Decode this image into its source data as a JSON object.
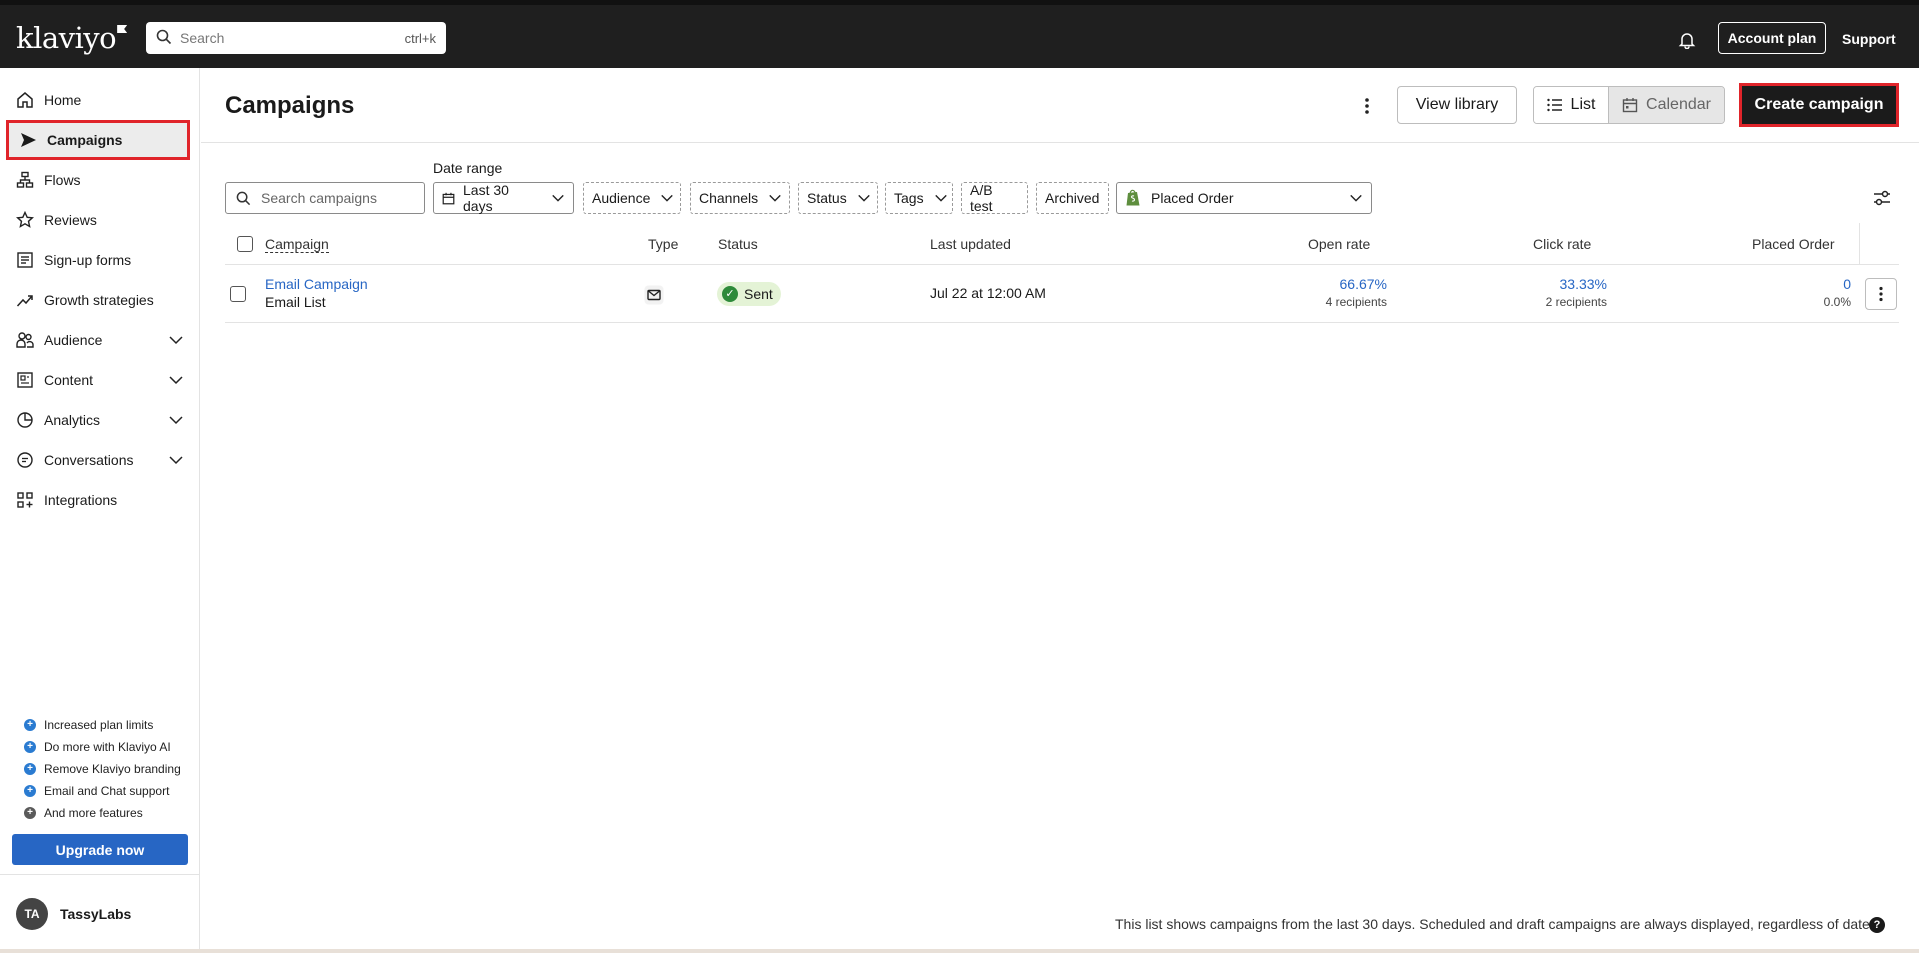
{
  "topbar": {
    "logo": "klaviyo",
    "search_placeholder": "Search",
    "search_shortcut": "ctrl+k",
    "account_plan": "Account plan",
    "support": "Support"
  },
  "sidebar": {
    "items": [
      {
        "label": "Home",
        "icon": "home-icon"
      },
      {
        "label": "Campaigns",
        "icon": "send-icon"
      },
      {
        "label": "Flows",
        "icon": "flows-icon"
      },
      {
        "label": "Reviews",
        "icon": "star-icon"
      },
      {
        "label": "Sign-up forms",
        "icon": "form-icon"
      },
      {
        "label": "Growth strategies",
        "icon": "trend-icon"
      },
      {
        "label": "Audience",
        "icon": "people-icon"
      },
      {
        "label": "Content",
        "icon": "content-icon"
      },
      {
        "label": "Analytics",
        "icon": "pie-icon"
      },
      {
        "label": "Conversations",
        "icon": "chat-icon"
      },
      {
        "label": "Integrations",
        "icon": "grid-icon"
      }
    ],
    "perks": [
      "Increased plan limits",
      "Do more with Klaviyo AI",
      "Remove Klaviyo branding",
      "Email and Chat support",
      "And more features"
    ],
    "upgrade_label": "Upgrade now",
    "account_initials": "TA",
    "account_name": "TassyLabs"
  },
  "main": {
    "title": "Campaigns",
    "view_library": "View library",
    "view_list": "List",
    "view_calendar": "Calendar",
    "create_campaign": "Create campaign",
    "date_range_label": "Date range",
    "search_placeholder": "Search campaigns",
    "filters": {
      "date": "Last 30 days",
      "audience": "Audience",
      "channels": "Channels",
      "status": "Status",
      "tags": "Tags",
      "ab_test": "A/B test",
      "archived": "Archived",
      "metric": "Placed Order"
    },
    "table": {
      "headers": {
        "campaign": "Campaign",
        "type": "Type",
        "status": "Status",
        "last_updated": "Last updated",
        "open_rate": "Open rate",
        "click_rate": "Click rate",
        "placed_order": "Placed Order"
      },
      "rows": [
        {
          "name": "Email Campaign",
          "list": "Email List",
          "status": "Sent",
          "last_updated": "Jul 22 at 12:00 AM",
          "open_rate": "66.67%",
          "open_recipients": "4 recipients",
          "click_rate": "33.33%",
          "click_recipients": "2 recipients",
          "placed_order": "0",
          "placed_order_pct": "0.0%"
        }
      ]
    },
    "footer_note": "This list shows campaigns from the last 30 days. Scheduled and draft campaigns are always displayed, regardless of date.",
    "help": "?"
  },
  "colors": {
    "accent_blue": "#2766c4",
    "highlight_red": "#e0242a",
    "topbar_bg": "#1f1f1f",
    "success_green": "#2e8a3a"
  }
}
